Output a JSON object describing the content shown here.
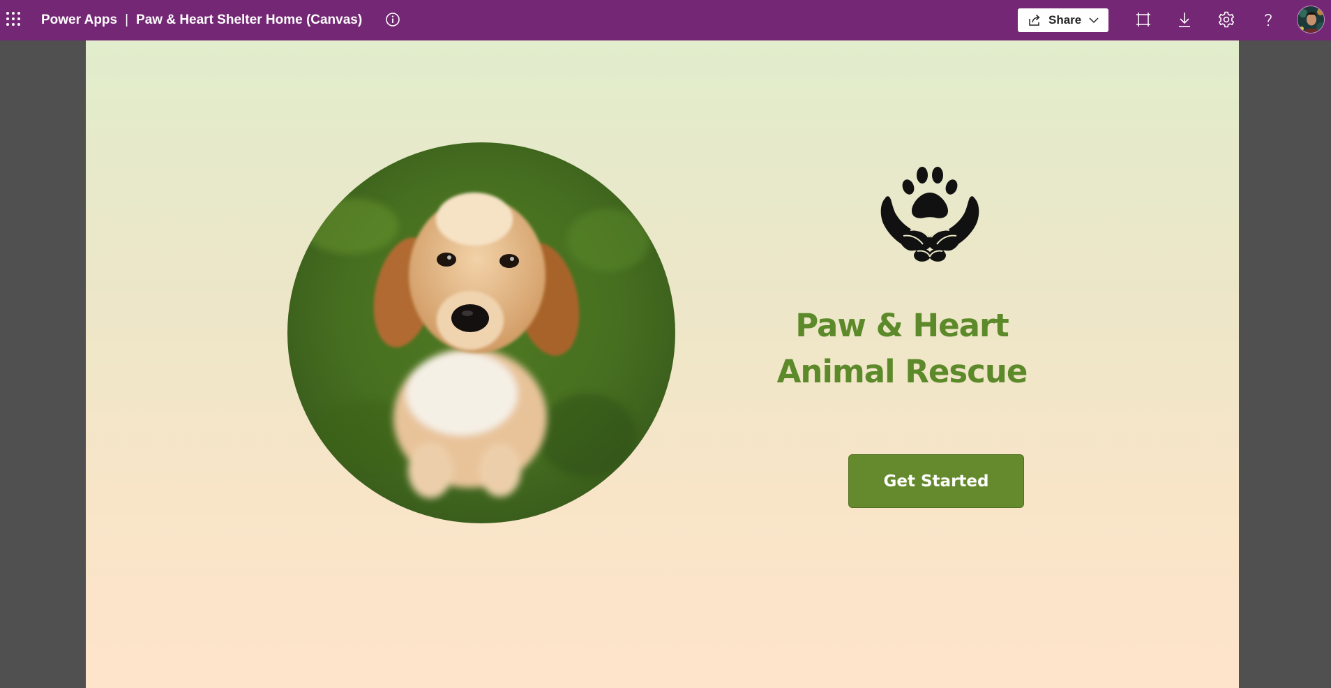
{
  "header": {
    "app_name": "Power Apps",
    "separator": "|",
    "app_title": "Paw & Heart Shelter Home (Canvas)",
    "share_label": "Share",
    "icons": [
      "waffle-icon",
      "info-icon",
      "share-icon",
      "chevron-down-icon",
      "fit-to-screen-icon",
      "download-icon",
      "settings-icon",
      "help-icon",
      "avatar"
    ]
  },
  "canvas": {
    "title_line1": "Paw & Heart",
    "title_line2": "Animal Rescue",
    "button_label": "Get Started",
    "logo": "paw-in-hands-logo",
    "photo": "cocker-spaniel-puppy-photo"
  },
  "colors": {
    "topbar": "#742774",
    "brand_green": "#5c8a2a",
    "button_green": "#658a2e",
    "gradient_top": "#e1edcc",
    "gradient_bottom": "#fee4cb",
    "page_bg": "#505050"
  }
}
